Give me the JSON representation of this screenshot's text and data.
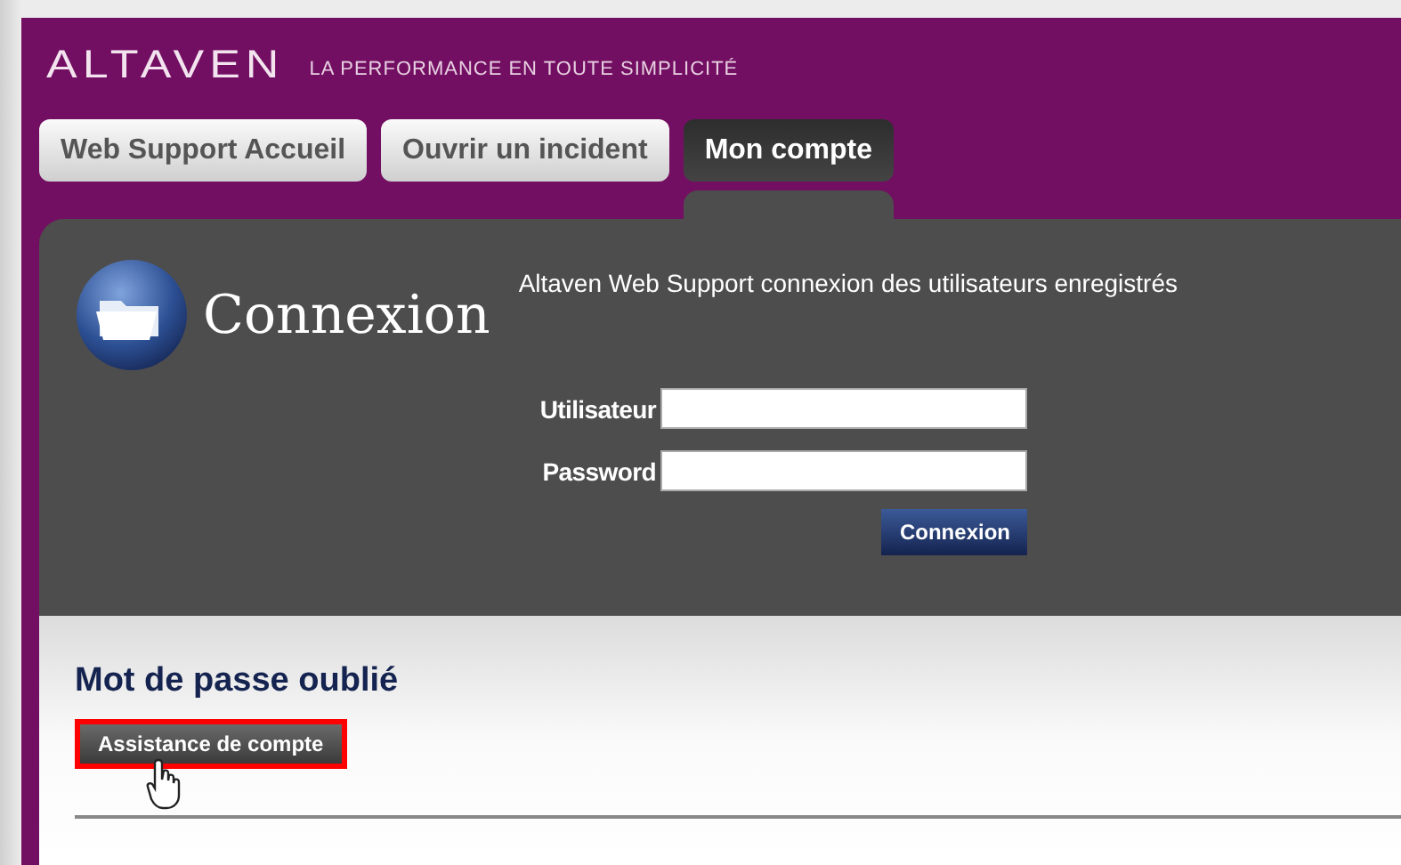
{
  "header": {
    "logo": "ALTAVEN",
    "tagline": "LA PERFORMANCE EN TOUTE SIMPLICITÉ"
  },
  "tabs": [
    {
      "label": "Web Support Accueil",
      "selected": false
    },
    {
      "label": "Ouvrir un incident",
      "selected": false
    },
    {
      "label": "Mon compte",
      "selected": true
    }
  ],
  "login": {
    "title": "Connexion",
    "subtitle": "Altaven Web Support connexion des utilisateurs enregistrés",
    "fields": [
      {
        "label": "Utilisateur"
      },
      {
        "label": "Password"
      }
    ],
    "submit": "Connexion"
  },
  "forgot": {
    "title": "Mot de passe oublié",
    "button": "Assistance de compte",
    "highlighted": true
  }
}
